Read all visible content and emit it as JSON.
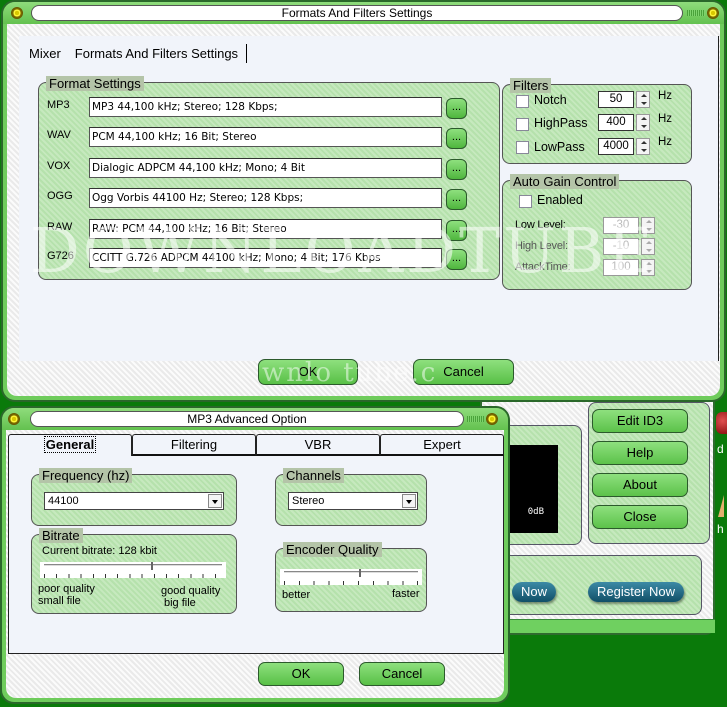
{
  "formats_window": {
    "title": "Formats And Filters Settings",
    "tabs": [
      {
        "label": "Mixer",
        "active": false
      },
      {
        "label": "Formats And Filters Settings",
        "active": true
      }
    ],
    "format_settings": {
      "legend": "Format Settings",
      "rows": [
        {
          "label": "MP3",
          "value": "MP3 44,100 kHz; Stereo;  128 Kbps;",
          "button": "..."
        },
        {
          "label": "WAV",
          "value": "PCM 44,100 kHz; 16 Bit; Stereo",
          "button": "..."
        },
        {
          "label": "VOX",
          "value": "Dialogic ADPCM 44,100 kHz; Mono; 4 Bit",
          "button": "..."
        },
        {
          "label": "OGG",
          "value": "Ogg Vorbis 44100 Hz; Stereo; 128 Kbps;",
          "button": "..."
        },
        {
          "label": "RAW",
          "value": "RAW: PCM 44,100 kHz; 16 Bit; Stereo",
          "button": "..."
        },
        {
          "label": "G726",
          "value": "CCITT G.726 ADPCM 44100 kHz; Mono; 4 Bit; 176 Kbps",
          "button": "..."
        }
      ]
    },
    "filters": {
      "legend": "Filters",
      "items": [
        {
          "label": "Notch",
          "checked": false,
          "value": "50",
          "unit": "Hz"
        },
        {
          "label": "HighPass",
          "checked": false,
          "value": "400",
          "unit": "Hz"
        },
        {
          "label": "LowPass",
          "checked": false,
          "value": "4000",
          "unit": "Hz"
        }
      ]
    },
    "agc": {
      "legend": "Auto Gain Control",
      "enabled_label": "Enabled",
      "enabled": false,
      "fields": [
        {
          "label": "Low Level:",
          "value": "-30"
        },
        {
          "label": "High Level:",
          "value": "-10"
        },
        {
          "label": "AttackTime:",
          "value": "100"
        }
      ]
    },
    "ok_label": "OK",
    "cancel_label": "Cancel"
  },
  "watermark": {
    "text": "DOWNLOADTUBE",
    "text_small": "wnlo   tube.c"
  },
  "mp3_window": {
    "title": "MP3 Advanced Option",
    "tabs": [
      {
        "label": "General",
        "active": true
      },
      {
        "label": "Filtering",
        "active": false
      },
      {
        "label": "VBR",
        "active": false
      },
      {
        "label": "Expert",
        "active": false
      }
    ],
    "frequency": {
      "legend": "Frequency (hz)",
      "value": "44100"
    },
    "channels": {
      "legend": "Channels",
      "value": "Stereo"
    },
    "bitrate": {
      "legend": "Bitrate",
      "current": "Current bitrate: 128 kbit",
      "slider_position": 0.6,
      "left_label_1": "poor quality",
      "left_label_2": "small file",
      "right_label_1": "good quality",
      "right_label_2": "big file"
    },
    "encoder_quality": {
      "legend": "Encoder Quality",
      "slider_position": 0.56,
      "left_label": "better",
      "right_label": "faster"
    },
    "ok_label": "OK",
    "cancel_label": "Cancel"
  },
  "background_app": {
    "meter_label": "0dB",
    "buttons": [
      "Edit ID3",
      "Help",
      "About",
      "Close"
    ],
    "buy_label": "Now",
    "register_label": "Register Now",
    "edge_text_1": "d",
    "edge_text_2": "h"
  }
}
